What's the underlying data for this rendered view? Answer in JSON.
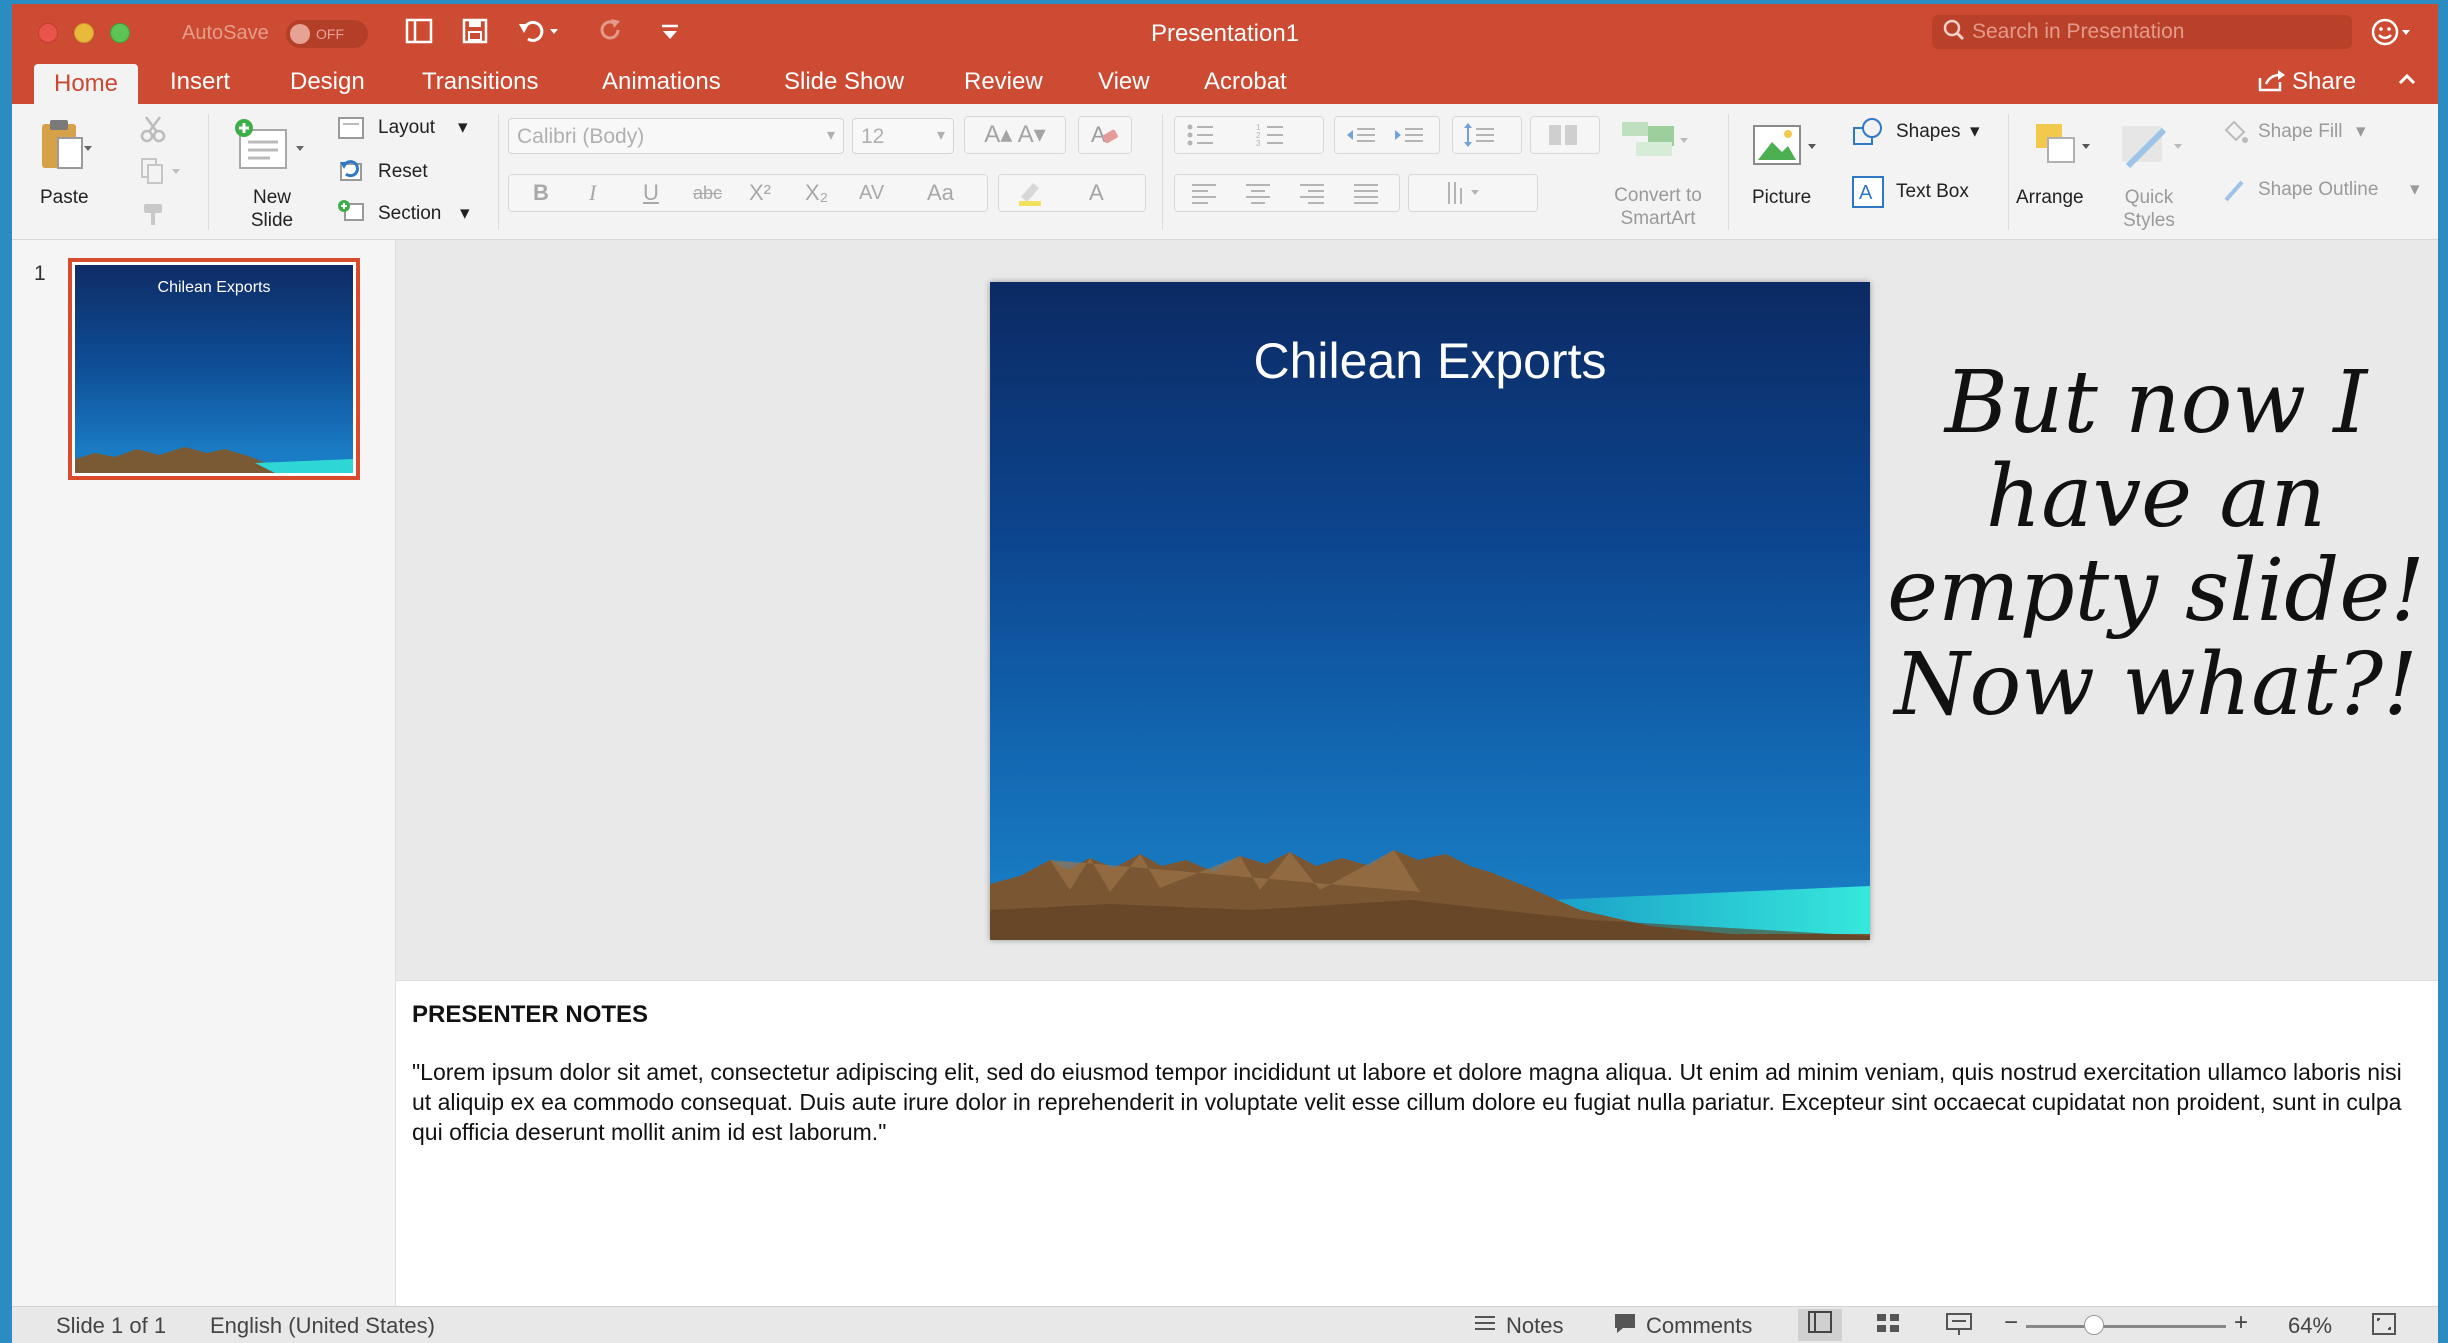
{
  "titlebar": {
    "autosave_label": "AutoSave",
    "autosave_state": "OFF",
    "title": "Presentation1",
    "search_placeholder": "Search in Presentation"
  },
  "tabs": [
    {
      "label": "Home",
      "active": true
    },
    {
      "label": "Insert"
    },
    {
      "label": "Design"
    },
    {
      "label": "Transitions"
    },
    {
      "label": "Animations"
    },
    {
      "label": "Slide Show"
    },
    {
      "label": "Review"
    },
    {
      "label": "View"
    },
    {
      "label": "Acrobat"
    }
  ],
  "share_label": "Share",
  "ribbon": {
    "paste": "Paste",
    "new_slide": "New Slide",
    "layout": "Layout",
    "reset": "Reset",
    "section": "Section",
    "font_name": "Calibri (Body)",
    "font_size": "12",
    "format": {
      "bold": "B",
      "italic": "I",
      "underline": "U",
      "strike": "abc",
      "superscript": "X²",
      "subscript": "X₂",
      "spacing": "AV",
      "case": "Aa",
      "font_color": "A"
    },
    "convert_smartart": "Convert to SmartArt",
    "picture": "Picture",
    "shapes": "Shapes",
    "text_box": "Text Box",
    "arrange": "Arrange",
    "quick_styles": "Quick Styles",
    "shape_fill": "Shape Fill",
    "shape_outline": "Shape Outline"
  },
  "thumbnails": [
    {
      "number": "1",
      "title": "Chilean Exports"
    }
  ],
  "slide": {
    "title": "Chilean Exports"
  },
  "annotation": "But now I have an empty slide! Now what?!",
  "notes": {
    "heading": "PRESENTER NOTES",
    "body": "\"Lorem ipsum dolor sit amet, consectetur adipiscing elit, sed do eiusmod tempor incididunt ut labore et dolore magna aliqua. Ut enim ad minim veniam, quis nostrud exercitation ullamco laboris nisi ut aliquip ex ea commodo consequat. Duis aute irure dolor in reprehenderit in voluptate velit esse cillum dolore eu fugiat nulla pariatur. Excepteur sint occaecat cupidatat non proident, sunt in culpa qui officia deserunt mollit anim id est laborum.\""
  },
  "statusbar": {
    "slide_position": "Slide 1 of 1",
    "language": "English (United States)",
    "notes": "Notes",
    "comments": "Comments",
    "zoom": "64%"
  },
  "colors": {
    "accent": "#cc4b32",
    "thumb_border": "#d84b2f"
  }
}
